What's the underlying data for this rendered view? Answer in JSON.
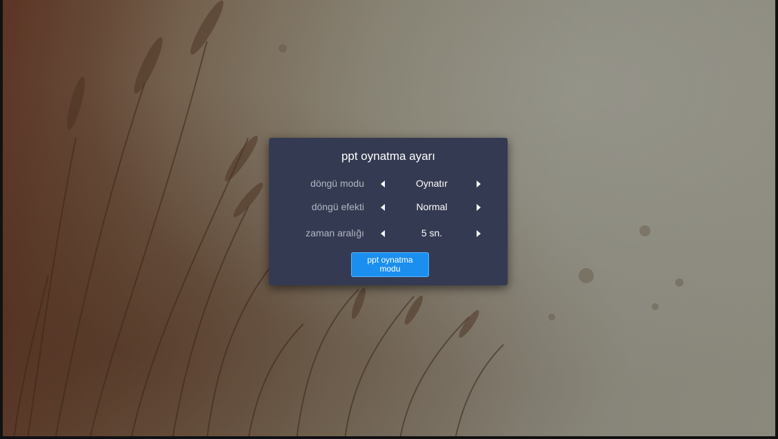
{
  "dialog": {
    "title": "ppt oynatma ayarı",
    "rows": [
      {
        "label": "döngü modu",
        "value": "Oynatır"
      },
      {
        "label": "döngü efekti",
        "value": "Normal"
      },
      {
        "label": "zaman aralığı",
        "value": "5 sn."
      }
    ],
    "button_label": "ppt oynatma modu"
  },
  "icons": {
    "prev": "caret-left-icon",
    "next": "caret-right-icon"
  },
  "colors": {
    "dialog_bg": "#343a51",
    "button_bg": "#1b8ff0",
    "label_text": "#b3b6c4",
    "value_text": "#ffffff"
  }
}
